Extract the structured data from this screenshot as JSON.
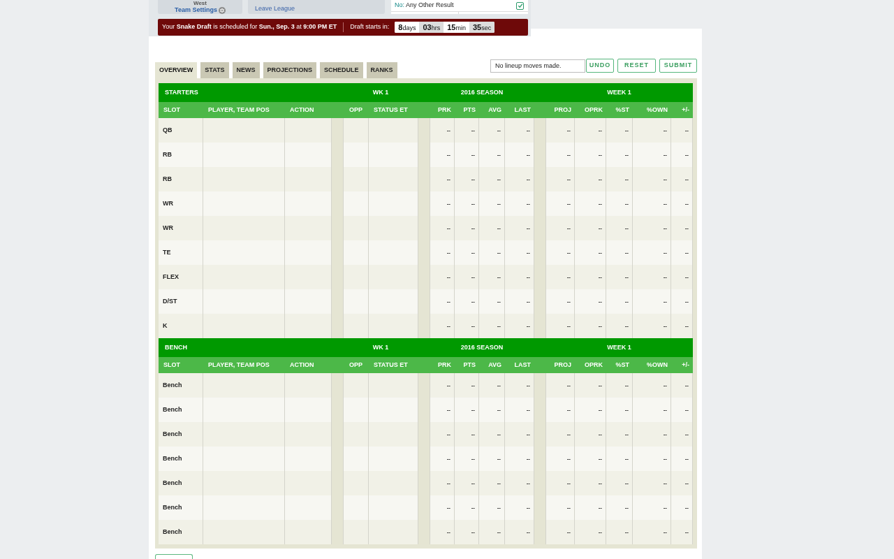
{
  "header": {
    "division": "West",
    "team_settings": "Team Settings",
    "leave_league": "Leave League",
    "option": {
      "prefix": "No:",
      "label": "Any Other Result",
      "checked": true
    }
  },
  "draft_banner": {
    "message": "Your **Snake Draft** is scheduled for **Sun., Sep. 3** at **9:00 PM ET**",
    "starts_label": "Draft starts in:",
    "countdown": [
      {
        "value": "8",
        "unit": "days"
      },
      {
        "value": "03",
        "unit": "hrs"
      },
      {
        "value": "15",
        "unit": "min"
      },
      {
        "value": "35",
        "unit": "sec"
      }
    ]
  },
  "tabs": [
    {
      "label": "OVERVIEW",
      "selected": true
    },
    {
      "label": "STATS",
      "selected": false
    },
    {
      "label": "NEWS",
      "selected": false
    },
    {
      "label": "PROJECTIONS",
      "selected": false
    },
    {
      "label": "SCHEDULE",
      "selected": false
    },
    {
      "label": "RANKS",
      "selected": false
    }
  ],
  "lineup_controls": {
    "status": "No lineup moves made.",
    "buttons": [
      "UNDO",
      "RESET",
      "SUBMIT"
    ]
  },
  "sections": [
    {
      "title": "STARTERS",
      "groups": [
        "WK 1",
        "2016 SEASON",
        "WEEK 1"
      ],
      "columns": [
        "SLOT",
        "PLAYER, TEAM POS",
        "ACTION",
        "OPP",
        "STATUS ET",
        "PRK",
        "PTS",
        "AVG",
        "LAST",
        "PROJ",
        "OPRK",
        "%ST",
        "%OWN",
        "+/-"
      ],
      "rows": [
        {
          "slot": "QB",
          "stats": [
            "--",
            "--",
            "--",
            "--",
            "--",
            "--",
            "--",
            "--",
            "--"
          ]
        },
        {
          "slot": "RB",
          "stats": [
            "--",
            "--",
            "--",
            "--",
            "--",
            "--",
            "--",
            "--",
            "--"
          ]
        },
        {
          "slot": "RB",
          "stats": [
            "--",
            "--",
            "--",
            "--",
            "--",
            "--",
            "--",
            "--",
            "--"
          ]
        },
        {
          "slot": "WR",
          "stats": [
            "--",
            "--",
            "--",
            "--",
            "--",
            "--",
            "--",
            "--",
            "--"
          ]
        },
        {
          "slot": "WR",
          "stats": [
            "--",
            "--",
            "--",
            "--",
            "--",
            "--",
            "--",
            "--",
            "--"
          ]
        },
        {
          "slot": "TE",
          "stats": [
            "--",
            "--",
            "--",
            "--",
            "--",
            "--",
            "--",
            "--",
            "--"
          ]
        },
        {
          "slot": "FLEX",
          "stats": [
            "--",
            "--",
            "--",
            "--",
            "--",
            "--",
            "--",
            "--",
            "--"
          ]
        },
        {
          "slot": "D/ST",
          "stats": [
            "--",
            "--",
            "--",
            "--",
            "--",
            "--",
            "--",
            "--",
            "--"
          ]
        },
        {
          "slot": "K",
          "stats": [
            "--",
            "--",
            "--",
            "--",
            "--",
            "--",
            "--",
            "--",
            "--"
          ]
        }
      ]
    },
    {
      "title": "BENCH",
      "groups": [
        "WK 1",
        "2016 SEASON",
        "WEEK 1"
      ],
      "columns": [
        "SLOT",
        "PLAYER, TEAM POS",
        "ACTION",
        "OPP",
        "STATUS ET",
        "PRK",
        "PTS",
        "AVG",
        "LAST",
        "PROJ",
        "OPRK",
        "%ST",
        "%OWN",
        "+/-"
      ],
      "rows": [
        {
          "slot": "Bench",
          "stats": [
            "--",
            "--",
            "--",
            "--",
            "--",
            "--",
            "--",
            "--",
            "--"
          ]
        },
        {
          "slot": "Bench",
          "stats": [
            "--",
            "--",
            "--",
            "--",
            "--",
            "--",
            "--",
            "--",
            "--"
          ]
        },
        {
          "slot": "Bench",
          "stats": [
            "--",
            "--",
            "--",
            "--",
            "--",
            "--",
            "--",
            "--",
            "--"
          ]
        },
        {
          "slot": "Bench",
          "stats": [
            "--",
            "--",
            "--",
            "--",
            "--",
            "--",
            "--",
            "--",
            "--"
          ]
        },
        {
          "slot": "Bench",
          "stats": [
            "--",
            "--",
            "--",
            "--",
            "--",
            "--",
            "--",
            "--",
            "--"
          ]
        },
        {
          "slot": "Bench",
          "stats": [
            "--",
            "--",
            "--",
            "--",
            "--",
            "--",
            "--",
            "--",
            "--"
          ]
        },
        {
          "slot": "Bench",
          "stats": [
            "--",
            "--",
            "--",
            "--",
            "--",
            "--",
            "--",
            "--",
            "--"
          ]
        }
      ]
    }
  ]
}
